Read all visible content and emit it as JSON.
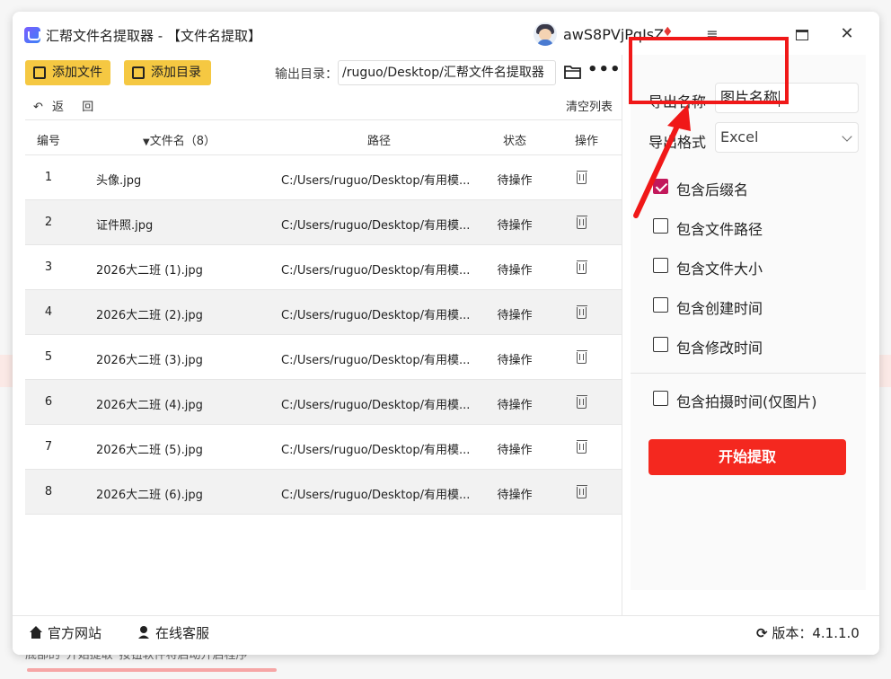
{
  "app": {
    "title": "汇帮文件名提取器 - 【文件名提取】",
    "username": "awS8PVjPqIsZ",
    "window_menu_icon": "menu-icon",
    "window_max_icon": "maximize-icon",
    "window_close_icon": "close-icon"
  },
  "toolbar": {
    "add_file": "添加文件",
    "add_dir": "添加目录",
    "output_label": "输出目录：",
    "output_path": "/ruguo/Desktop/汇帮文件名提取器",
    "more": "•••"
  },
  "subbar": {
    "back": "返",
    "back2": "回",
    "clear": "清空列表"
  },
  "table": {
    "headers": {
      "num": "编号",
      "name": "文件名（8）",
      "path": "路径",
      "status": "状态",
      "op": "操作"
    },
    "rows": [
      {
        "num": "1",
        "name": "头像.jpg",
        "path": "C:/Users/ruguo/Desktop/有用模...",
        "status": "待操作"
      },
      {
        "num": "2",
        "name": "证件照.jpg",
        "path": "C:/Users/ruguo/Desktop/有用模...",
        "status": "待操作"
      },
      {
        "num": "3",
        "name": "2026大二班 (1).jpg",
        "path": "C:/Users/ruguo/Desktop/有用模...",
        "status": "待操作"
      },
      {
        "num": "4",
        "name": "2026大二班 (2).jpg",
        "path": "C:/Users/ruguo/Desktop/有用模...",
        "status": "待操作"
      },
      {
        "num": "5",
        "name": "2026大二班 (3).jpg",
        "path": "C:/Users/ruguo/Desktop/有用模...",
        "status": "待操作"
      },
      {
        "num": "6",
        "name": "2026大二班 (4).jpg",
        "path": "C:/Users/ruguo/Desktop/有用模...",
        "status": "待操作"
      },
      {
        "num": "7",
        "name": "2026大二班 (5).jpg",
        "path": "C:/Users/ruguo/Desktop/有用模...",
        "status": "待操作"
      },
      {
        "num": "8",
        "name": "2026大二班 (6).jpg",
        "path": "C:/Users/ruguo/Desktop/有用模...",
        "status": "待操作"
      }
    ]
  },
  "panel": {
    "export_name_label": "导出名称",
    "export_name_value": "图片名称",
    "export_format_label": "导出格式",
    "export_format_value": "Excel",
    "options": [
      {
        "label": "包含后缀名",
        "checked": true
      },
      {
        "label": "包含文件路径",
        "checked": false
      },
      {
        "label": "包含文件大小",
        "checked": false
      },
      {
        "label": "包含创建时间",
        "checked": false
      },
      {
        "label": "包含修改时间",
        "checked": false
      },
      {
        "label": "包含拍摄时间(仅图片)",
        "checked": false
      }
    ],
    "start_button": "开始提取"
  },
  "footer": {
    "website": "官方网站",
    "support": "在线客服",
    "version_label": "版本：",
    "version": "4.1.1.0"
  },
  "background": {
    "bottom_text": "底部的“开始提取”按钮软件将启动开启程序"
  },
  "colors": {
    "accent_yellow": "#f5c842",
    "start_red": "#f4281f",
    "annotation_red": "#f01818",
    "checkbox_on": "#c2185b"
  }
}
